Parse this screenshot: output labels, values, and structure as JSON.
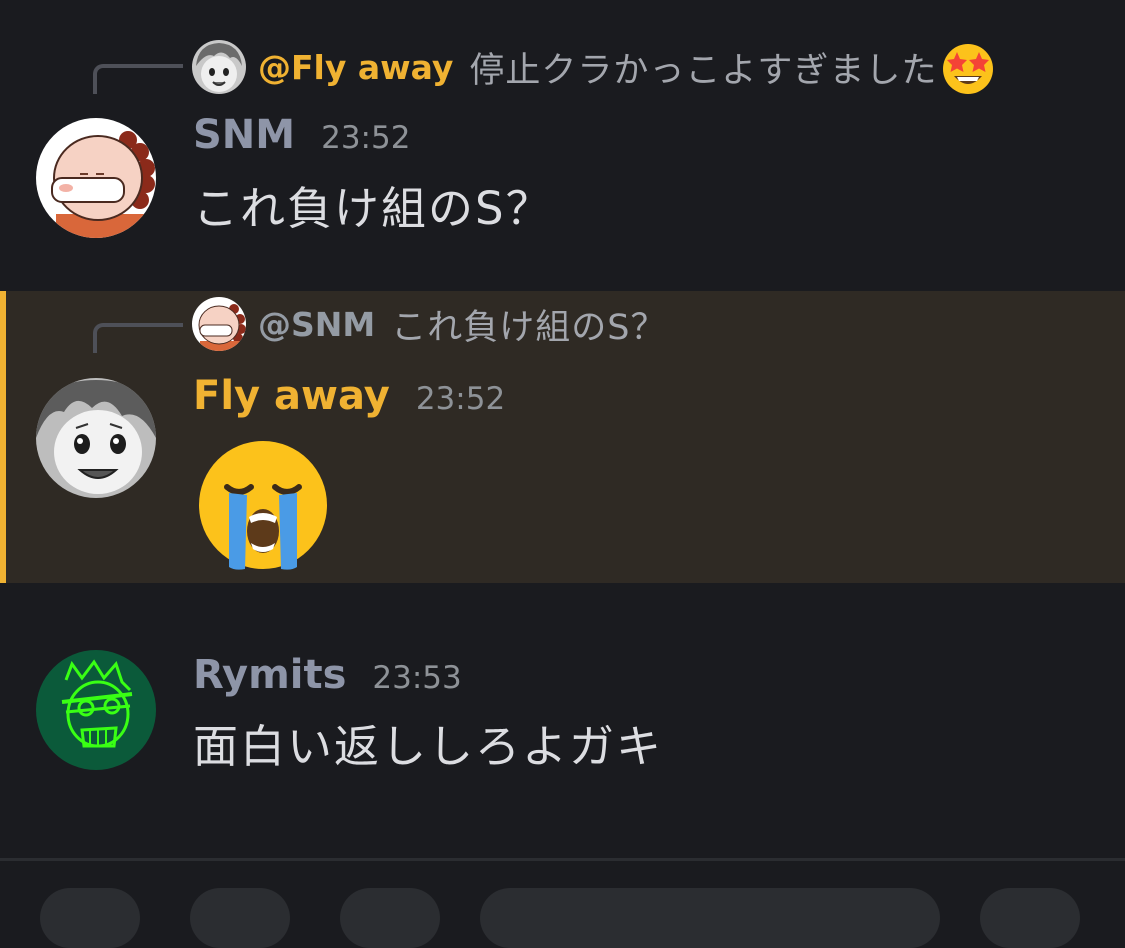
{
  "colors": {
    "background": "#1a1b1f",
    "mention_highlight": "#2f2a24",
    "mention_bar": "#f0b232",
    "username_yellow": "#f0b232",
    "username_grey": "#8e95a8",
    "reply_line": "#4e5058"
  },
  "messages": [
    {
      "reply": {
        "avatar_icon": "manga-boy-avatar",
        "author": "@Fly away",
        "text": "停止クラかっこよすぎました",
        "trailing_emoji": "star-struck-emoji"
      },
      "avatar_icon": "bald-man-avatar",
      "author": "SNM",
      "time": "23:52",
      "text": "これ負け組のS？"
    },
    {
      "highlighted": true,
      "reply": {
        "avatar_icon": "bald-man-avatar",
        "author": "@SNM",
        "text": "これ負け組のS？"
      },
      "avatar_icon": "manga-boy-avatar",
      "author": "Fly away",
      "time": "23:52",
      "content_emoji": "loudly-crying-emoji"
    },
    {
      "avatar_icon": "green-neon-character-avatar",
      "author": "Rymits",
      "time": "23:53",
      "text": "面白い返ししろよガキ"
    }
  ]
}
